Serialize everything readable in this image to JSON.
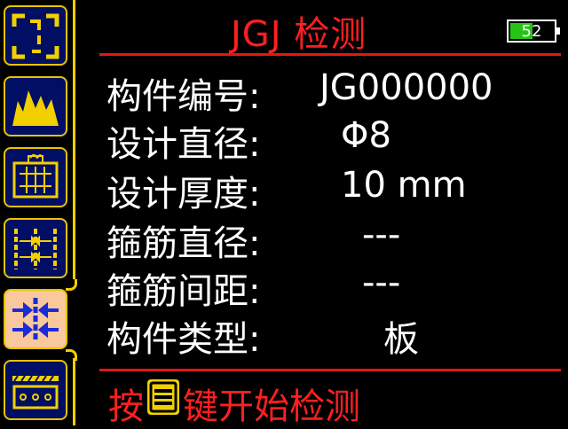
{
  "header": {
    "title": "JGJ 检测",
    "battery_percent": 52,
    "battery_text": "52"
  },
  "sidebar": {
    "items": [
      {
        "icon": "bracket-frame-icon",
        "active": false
      },
      {
        "icon": "mountain-peaks-icon",
        "active": false
      },
      {
        "icon": "grid-mesh-icon",
        "active": false
      },
      {
        "icon": "rebar-spacing-icon",
        "active": false
      },
      {
        "icon": "arrows-inward-icon",
        "active": true
      },
      {
        "icon": "slab-layer-icon",
        "active": false
      }
    ]
  },
  "fields": [
    {
      "label": "构件编号:",
      "value": "JG000000"
    },
    {
      "label": "设计直径:",
      "value": "Φ8"
    },
    {
      "label": "设计厚度:",
      "value": "10 mm"
    },
    {
      "label": "箍筋直径:",
      "value": "---"
    },
    {
      "label": "箍筋间距:",
      "value": "---"
    },
    {
      "label": "构件类型:",
      "value": "板"
    }
  ],
  "footer": {
    "prefix": "按",
    "suffix": "键开始检测",
    "key_icon": "menu-key-icon"
  },
  "colors": {
    "accent_red": "#ff1f1f",
    "sidebar_border": "#e8c400",
    "tile_bg": "#000f63",
    "tile_active_bg": "#f9c89d",
    "battery_fill": "#27c219"
  }
}
